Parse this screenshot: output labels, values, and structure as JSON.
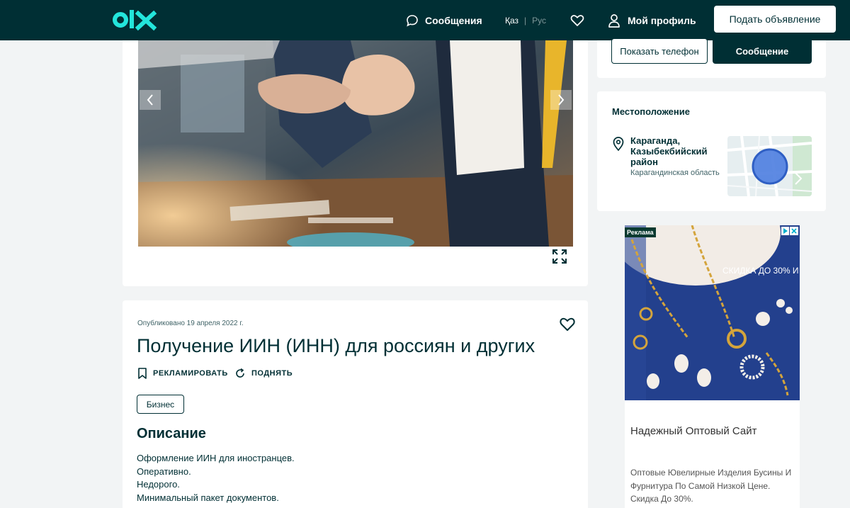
{
  "header": {
    "logo_text": "olx",
    "messages_label": "Сообщения",
    "lang_kaz": "Қаз",
    "lang_sep": "|",
    "lang_rus": "Рус",
    "profile_label": "Мой профиль",
    "post_button": "Подать объявление"
  },
  "contact": {
    "phone_button": "Показать телефон",
    "message_button": "Сообщение"
  },
  "location": {
    "title": "Местоположение",
    "city": "Караганда, Казыбекбийский район",
    "region": "Карагандинская область"
  },
  "listing": {
    "published": "Опубликовано 19 апреля 2022 г.",
    "title": "Получение ИИН (ИНН) для россиян и других",
    "promote_label": "РЕКЛАМИРОВАТЬ",
    "bump_label": "ПОДНЯТЬ",
    "category": "Бизнес",
    "description_title": "Описание",
    "description_lines": [
      "Оформление ИИН для иностранцев.",
      "Оперативно.",
      "Недорого.",
      "Минимальный пакет документов."
    ]
  },
  "ad": {
    "badge": "Реклама",
    "promo": "СКИДКА ДО 30% И",
    "headline": "Надежный Оптовый Сайт",
    "text": "Оптовые Ювелирные Изделия Бусины И Фурнитура По Самой Низкой Цене. Скидка До 30%."
  },
  "colors": {
    "brand_dark": "#002f34",
    "brand_teal": "#23e5db",
    "page_bg": "#f2f4f5"
  }
}
